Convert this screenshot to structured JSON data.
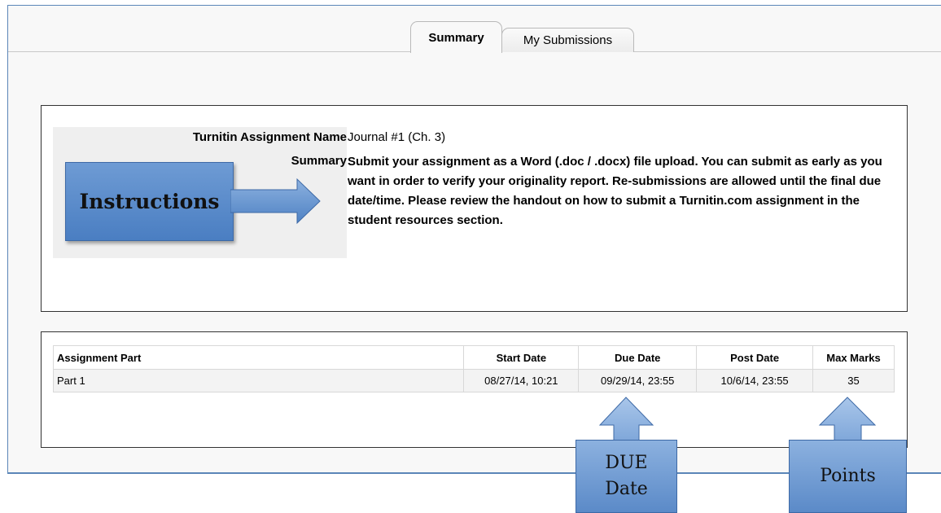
{
  "tabs": [
    {
      "label": "Summary",
      "active": true
    },
    {
      "label": "My Submissions",
      "active": false
    }
  ],
  "assignment": {
    "name_label": "Turnitin Assignment Name",
    "name_value": "Journal #1 (Ch. 3)",
    "summary_label": "Summary",
    "summary_value": "Submit your assignment as a Word (.doc / .docx) file upload. You can submit as early as you want in order to verify your originality report. Re-submissions are allowed until the final due date/time. Please review the handout on how to submit a Turnitin.com assignment in the student resources section."
  },
  "parts_table": {
    "headers": [
      "Assignment Part",
      "Start Date",
      "Due Date",
      "Post Date",
      "Max Marks"
    ],
    "rows": [
      [
        "Part 1",
        "08/27/14, 10:21",
        "09/29/14, 23:55",
        "10/6/14, 23:55",
        "35"
      ]
    ]
  },
  "annotations": {
    "instructions": "Instructions",
    "due_date_line1": "DUE",
    "due_date_line2": "Date",
    "points": "Points"
  },
  "colors": {
    "frame_border": "#5b86b8",
    "callout_fill": "#5b8ac8"
  }
}
